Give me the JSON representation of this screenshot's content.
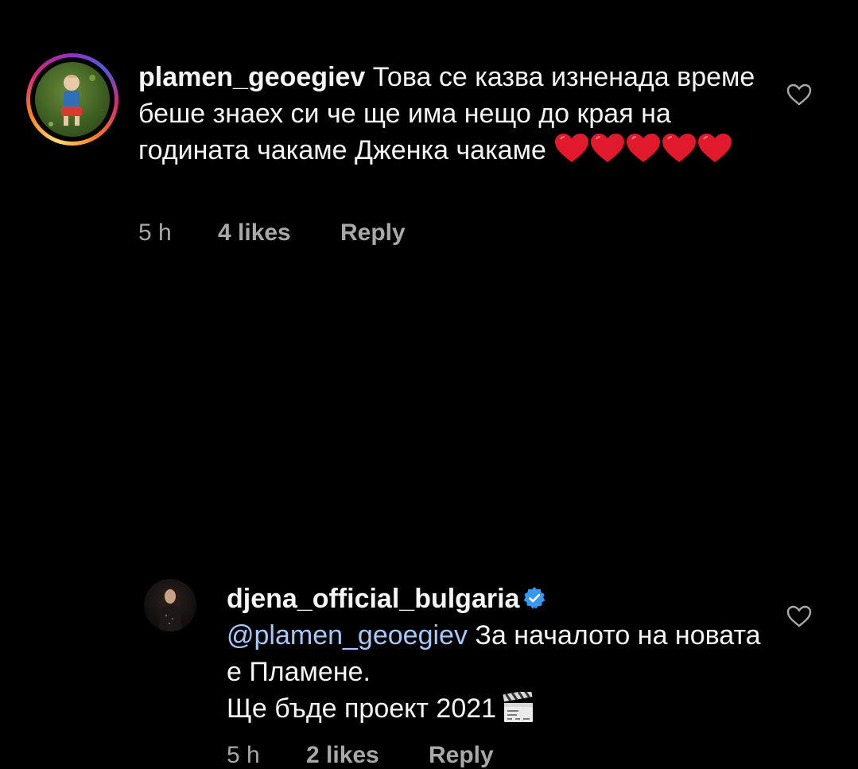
{
  "comments": [
    {
      "username": "plamen_geoegiev",
      "text": "Това се казва изненада време беше знаех си че ще има нещо до края на годината чакаме Дженка чакаме",
      "emoji": "red-heart x5",
      "time": "5 h",
      "likes": "4 likes",
      "reply": "Reply",
      "avatar": "profile photo of toddler on grass with story ring",
      "verified": false
    },
    {
      "username": "djena_official_bulgaria",
      "verified": true,
      "mention": "@plamen_geoegiev",
      "text_line1": "За началото на новата е Пламене.",
      "text_line2": "Ще бъде проект 2021",
      "emoji": "clapper-board",
      "time": "5 h",
      "likes": "2 likes",
      "reply": "Reply",
      "avatar": "profile photo of woman in dark outfit"
    }
  ],
  "icons": {
    "like": "heart-outline-icon",
    "verified": "verified-badge-icon"
  },
  "colors": {
    "background": "#000000",
    "text": "#f5f5f5",
    "secondary": "#a8a8a8",
    "mention": "#a8c7fa",
    "verified": "#3897f0",
    "heart": "#e0192d"
  }
}
